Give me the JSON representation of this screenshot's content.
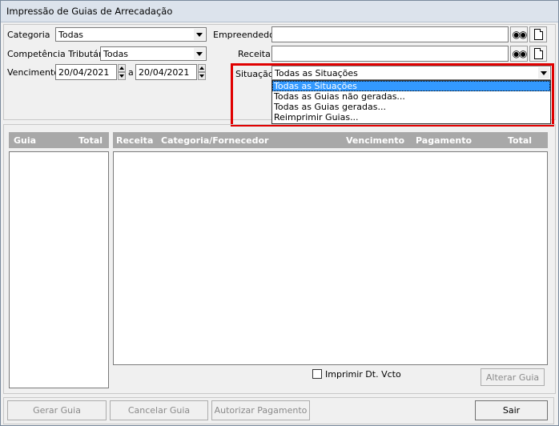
{
  "window": {
    "title": "Impressão de Guias de Arrecadação"
  },
  "filters": {
    "categoria_label": "Categoria",
    "categoria_value": "Todas",
    "competencia_label": "Competência Tributária",
    "competencia_value": "Todas",
    "vencimento_label": "Vencimento",
    "vencimento_from": "20/04/2021",
    "vencimento_sep": "a",
    "vencimento_to": "20/04/2021",
    "empreendedor_label": "Empreendedor",
    "empreendedor_value": "",
    "receita_label": "Receita",
    "receita_value": "",
    "situacao_label": "Situação",
    "situacao_value": "Todas as Situações",
    "situacao_options": [
      "Todas as Situações",
      "Todas as Guias não geradas...",
      "Todas as Guias geradas...",
      "Reimprimir Guias..."
    ]
  },
  "left_table": {
    "headers": [
      "Guia",
      "Total"
    ]
  },
  "right_table": {
    "headers": [
      "Receita",
      "Categoria/Fornecedor",
      "Vencimento",
      "Pagamento",
      "Total"
    ]
  },
  "checkbox": {
    "label": "Imprimir Dt. Vcto",
    "checked": false
  },
  "buttons": {
    "alterar": "Alterar Guia",
    "gerar": "Gerar Guia",
    "cancelar": "Cancelar Guia",
    "autorizar": "Autorizar Pagamento",
    "sair": "Sair"
  },
  "colors": {
    "highlight": "#3399ff",
    "annotation": "#e00000",
    "header_bg": "#a8a8a8"
  }
}
